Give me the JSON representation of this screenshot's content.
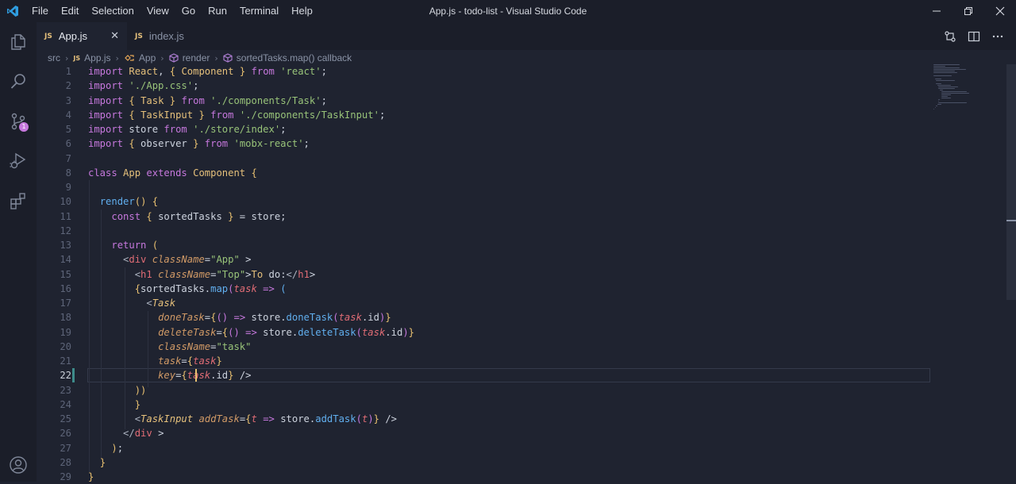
{
  "window": {
    "title": "App.js - todo-list - Visual Studio Code"
  },
  "menu": [
    "File",
    "Edit",
    "Selection",
    "View",
    "Go",
    "Run",
    "Terminal",
    "Help"
  ],
  "colors": {
    "accent": "#3d8b8a",
    "badge": "#c678dd",
    "cursor": "#e8c070"
  },
  "activity_bar": {
    "items": [
      "files-icon",
      "search-icon",
      "source-control-icon",
      "run-debug-icon",
      "extensions-icon"
    ],
    "scm_badge": "1"
  },
  "tabs": [
    {
      "label": "App.js",
      "icon": "JS",
      "active": true
    },
    {
      "label": "index.js",
      "icon": "JS",
      "active": false
    }
  ],
  "breadcrumb": [
    "src",
    "App.js",
    "App",
    "render",
    "sortedTasks.map() callback"
  ],
  "editor": {
    "current_line": 22,
    "line_numbers": [
      "1",
      "2",
      "3",
      "4",
      "5",
      "6",
      "7",
      "8",
      "9",
      "10",
      "11",
      "12",
      "13",
      "14",
      "15",
      "16",
      "17",
      "18",
      "19",
      "20",
      "21",
      "22",
      "23",
      "24",
      "25",
      "26",
      "27",
      "28",
      "29"
    ],
    "lines": [
      "import React, { Component } from 'react';",
      "import './App.css';",
      "import { Task } from './components/Task';",
      "import { TaskInput } from './components/TaskInput';",
      "import store from './store/index';",
      "import { observer } from 'mobx-react';",
      "",
      "class App extends Component {",
      "",
      "  render() {",
      "    const { sortedTasks } = store;",
      "",
      "    return (",
      "      <div className=\"App\" >",
      "        <h1 className=\"Top\">To do:</h1>",
      "        {sortedTasks.map(task => (",
      "          <Task",
      "            doneTask={() => store.doneTask(task.id)}",
      "            deleteTask={() => store.deleteTask(task.id)}",
      "            className=\"task\"",
      "            task={task}",
      "            key={task.id} />",
      "        ))",
      "        }",
      "        <TaskInput addTask={t => store.addTask(t)} />",
      "      </div >",
      "    );",
      "  }",
      "}"
    ]
  }
}
